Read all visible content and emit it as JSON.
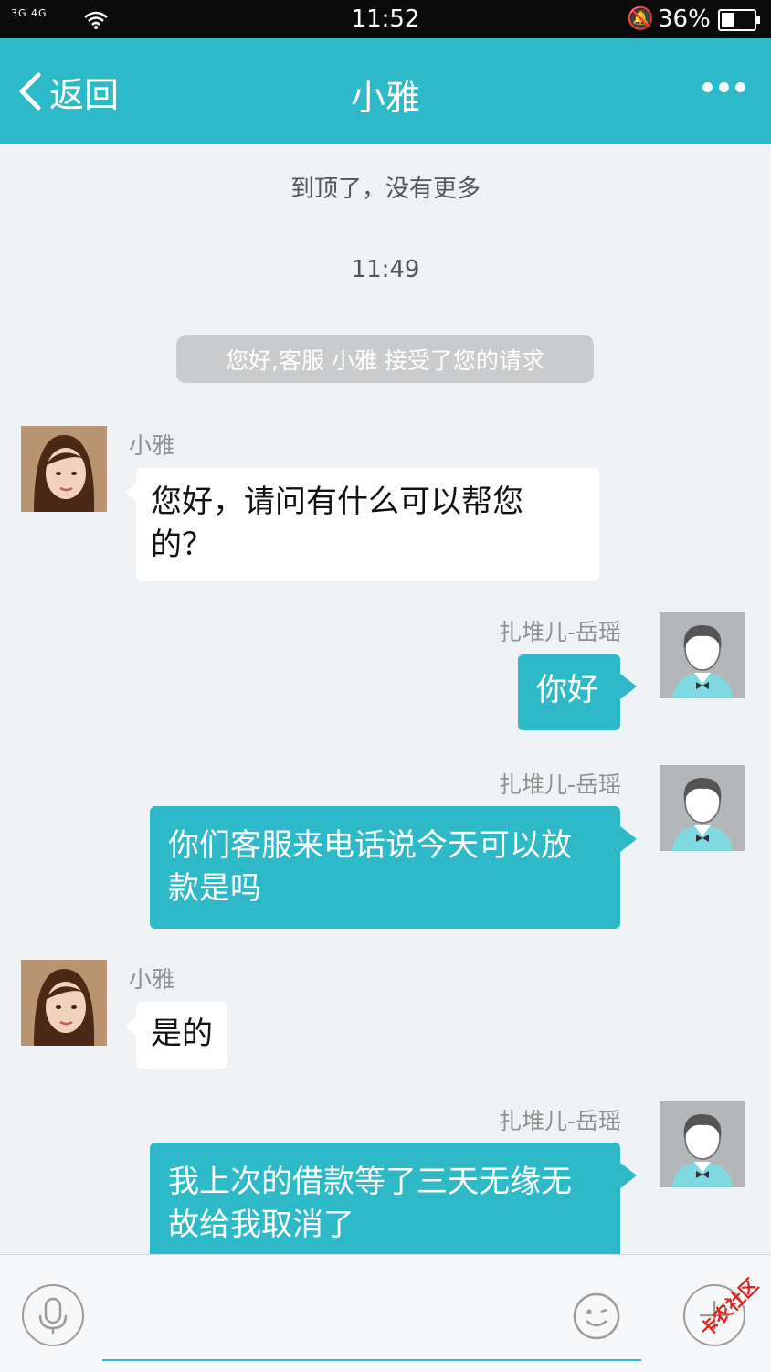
{
  "status_bar": {
    "signal_text": "3G 4G",
    "time": "11:52",
    "battery_percent": "36%",
    "battery_level": 0.36,
    "icons": [
      "signal-icon",
      "wifi-icon",
      "bell-off-icon",
      "battery-icon"
    ]
  },
  "header": {
    "back_label": "返回",
    "title": "小雅",
    "more_icon": "more-dots-icon"
  },
  "chat": {
    "top_notice": "到顶了，没有更多",
    "timestamp": "11:49",
    "system_message": "您好,客服 小雅 接受了您的请求",
    "messages": [
      {
        "from": "agent",
        "sender": "小雅",
        "text": "您好，请问有什么可以帮您的？"
      },
      {
        "from": "user",
        "sender": "扎堆儿-岳瑶",
        "text": "你好"
      },
      {
        "from": "user",
        "sender": "扎堆儿-岳瑶",
        "text": "你们客服来电话说今天可以放款是吗"
      },
      {
        "from": "agent",
        "sender": "小雅",
        "text": "是的"
      },
      {
        "from": "user",
        "sender": "扎堆儿-岳瑶",
        "text": "我上次的借款等了三天无缘无故给我取消了"
      }
    ]
  },
  "input_bar": {
    "placeholder": "",
    "icons": [
      "mic-icon",
      "emoji-icon",
      "plus-icon"
    ],
    "watermark": "卡农社区"
  },
  "colors": {
    "accent": "#2db9c7",
    "background": "#eef2f4",
    "status_bar": "#0b0b0b"
  }
}
